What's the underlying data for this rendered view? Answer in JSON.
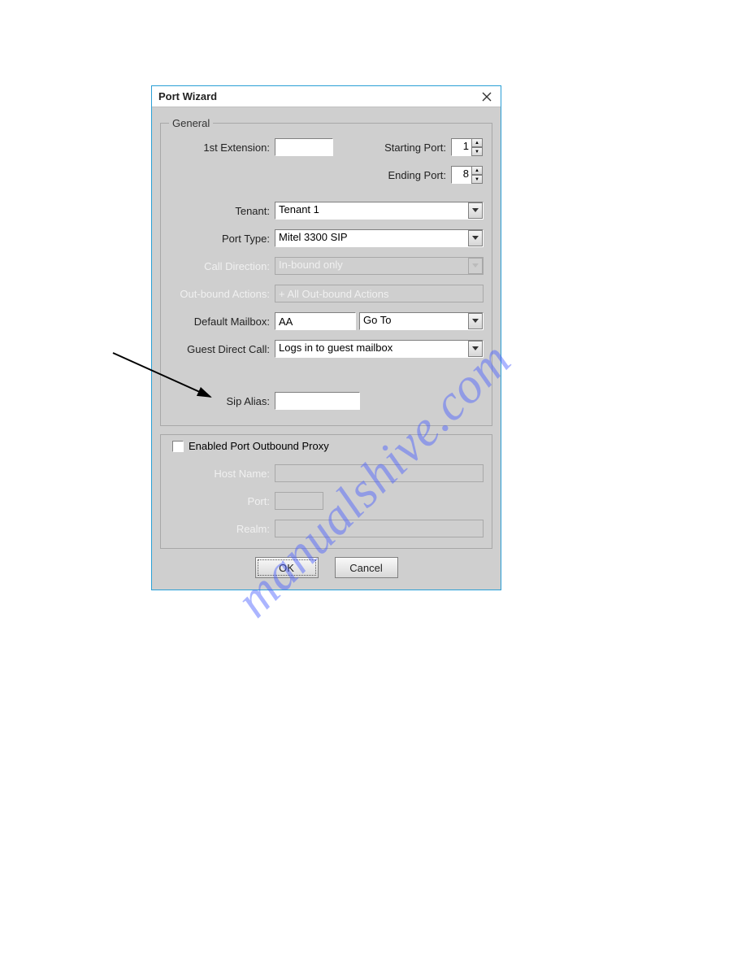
{
  "window": {
    "title": "Port Wizard"
  },
  "general": {
    "legend": "General",
    "first_ext_label": "1st Extension:",
    "first_ext_value": "",
    "starting_port_label": "Starting Port:",
    "starting_port_value": "1",
    "ending_port_label": "Ending Port:",
    "ending_port_value": "8",
    "tenant_label": "Tenant:",
    "tenant_value": "Tenant 1",
    "port_type_label": "Port Type:",
    "port_type_value": "Mitel 3300 SIP",
    "call_direction_label": "Call Direction:",
    "call_direction_value": "In-bound only",
    "outbound_actions_label": "Out-bound Actions:",
    "outbound_actions_value": "+ All Out-bound Actions",
    "default_mailbox_label": "Default Mailbox:",
    "default_mailbox_value": "AA",
    "default_mailbox_action": "Go To",
    "guest_direct_label": "Guest Direct Call:",
    "guest_direct_value": "Logs in to guest mailbox",
    "sip_alias_label": "Sip Alias:",
    "sip_alias_value": ""
  },
  "proxy": {
    "checkbox_label": "Enabled Port Outbound Proxy",
    "host_label": "Host Name:",
    "host_value": "",
    "port_label": "Port:",
    "port_value": "",
    "realm_label": "Realm:",
    "realm_value": ""
  },
  "buttons": {
    "ok": "OK",
    "cancel": "Cancel"
  },
  "watermark": "manualshive.com"
}
